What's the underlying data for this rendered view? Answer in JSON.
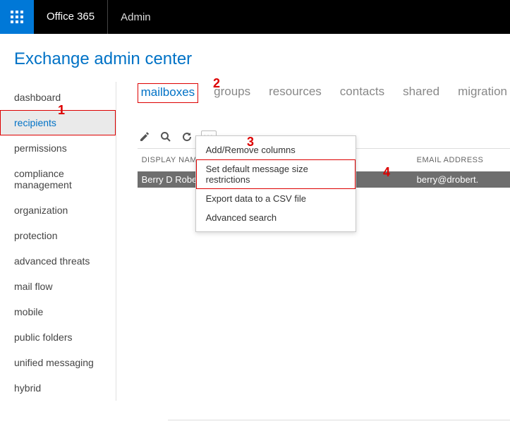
{
  "topbar": {
    "brand": "Office 365",
    "section": "Admin"
  },
  "page_title": "Exchange admin center",
  "sidebar": {
    "items": [
      {
        "label": "dashboard"
      },
      {
        "label": "recipients"
      },
      {
        "label": "permissions"
      },
      {
        "label": "compliance management"
      },
      {
        "label": "organization"
      },
      {
        "label": "protection"
      },
      {
        "label": "advanced threats"
      },
      {
        "label": "mail flow"
      },
      {
        "label": "mobile"
      },
      {
        "label": "public folders"
      },
      {
        "label": "unified messaging"
      },
      {
        "label": "hybrid"
      }
    ]
  },
  "tabs": [
    {
      "label": "mailboxes"
    },
    {
      "label": "groups"
    },
    {
      "label": "resources"
    },
    {
      "label": "contacts"
    },
    {
      "label": "shared"
    },
    {
      "label": "migration"
    }
  ],
  "grid": {
    "headers": {
      "name": "DISPLAY NAM",
      "email": "EMAIL ADDRESS"
    },
    "rows": [
      {
        "name": "Berry D Robe",
        "email": "berry@drobert."
      }
    ]
  },
  "more_menu": [
    "Add/Remove columns",
    "Set default message size restrictions",
    "Export data to a CSV file",
    "Advanced search"
  ],
  "ellipsis": "•••",
  "annotations": {
    "a1": "1",
    "a2": "2",
    "a3": "3",
    "a4": "4"
  }
}
